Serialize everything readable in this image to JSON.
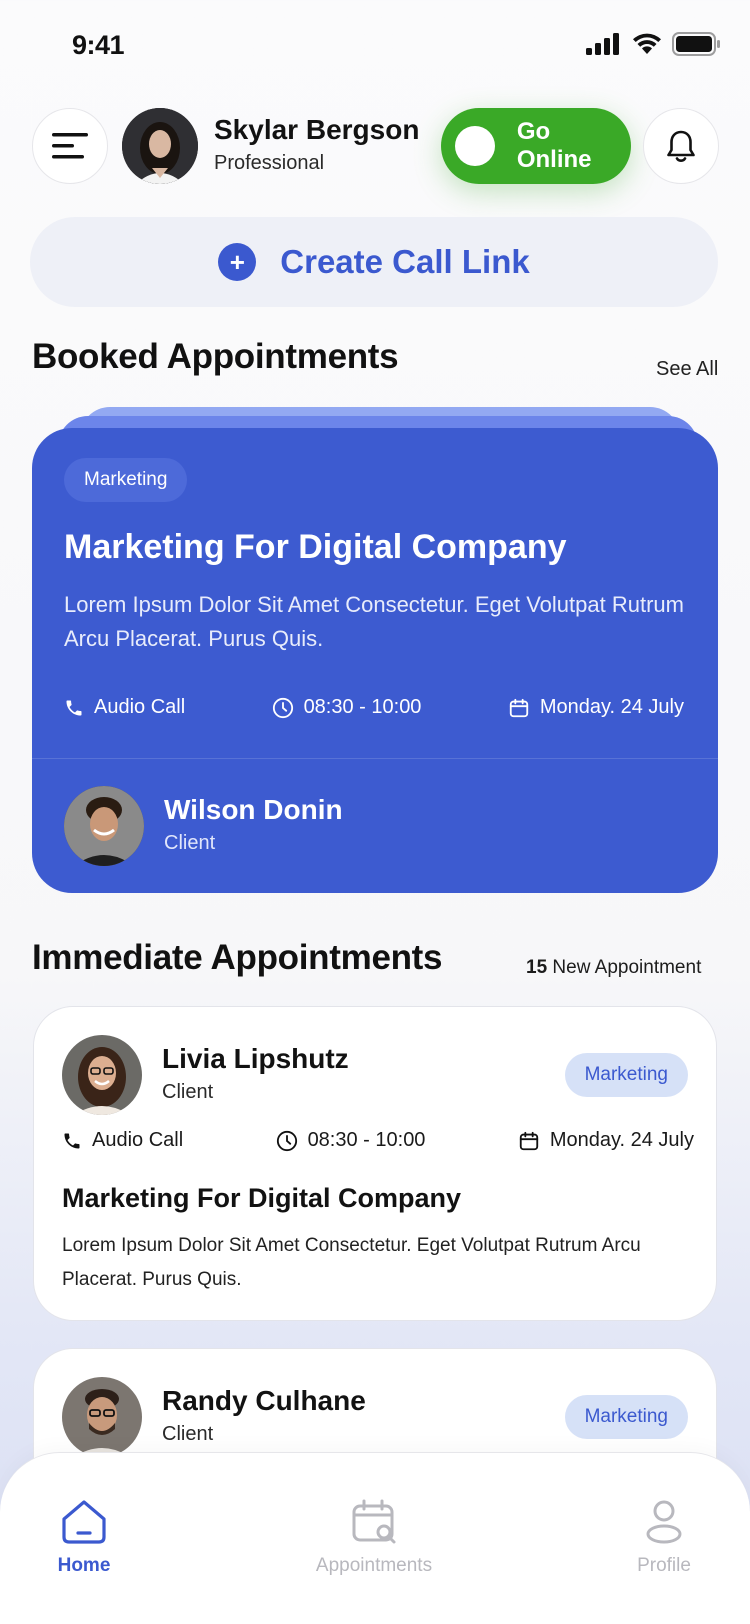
{
  "status_bar": {
    "time": "9:41"
  },
  "header": {
    "user_name": "Skylar Bergson",
    "user_role": "Professional",
    "online_button": "Go Online"
  },
  "create_call_link": {
    "label": "Create Call Link"
  },
  "booked": {
    "title": "Booked Appointments",
    "see_all": "See All",
    "card": {
      "tag": "Marketing",
      "title": "Marketing For Digital Company",
      "description": "Lorem Ipsum Dolor Sit Amet Consectetur. Eget Volutpat Rutrum Arcu Placerat. Purus Quis.",
      "call_type": "Audio Call",
      "time": "08:30 - 10:00",
      "date": "Monday. 24 July",
      "client_name": "Wilson Donin",
      "client_role": "Client"
    }
  },
  "immediate": {
    "title": "Immediate Appointments",
    "count": "15",
    "count_label": "New Appointment",
    "items": [
      {
        "name": "Livia Lipshutz",
        "role": "Client",
        "tag": "Marketing",
        "call_type": "Audio Call",
        "time": "08:30 - 10:00",
        "date": "Monday. 24 July",
        "title": "Marketing For Digital Company",
        "description": "Lorem Ipsum Dolor Sit Amet Consectetur. Eget Volutpat Rutrum Arcu Placerat. Purus Quis."
      },
      {
        "name": "Randy Culhane",
        "role": "Client",
        "tag": "Marketing"
      }
    ]
  },
  "bottom_nav": {
    "items": [
      {
        "label": "Home",
        "icon": "home-icon",
        "active": true
      },
      {
        "label": "Appointments",
        "icon": "calendar-search-icon",
        "active": false
      },
      {
        "label": "Profile",
        "icon": "profile-icon",
        "active": false
      }
    ]
  },
  "colors": {
    "primary": "#3d5bd0",
    "online_green": "#3aa927",
    "tag_light_bg": "#d6e1f7"
  }
}
